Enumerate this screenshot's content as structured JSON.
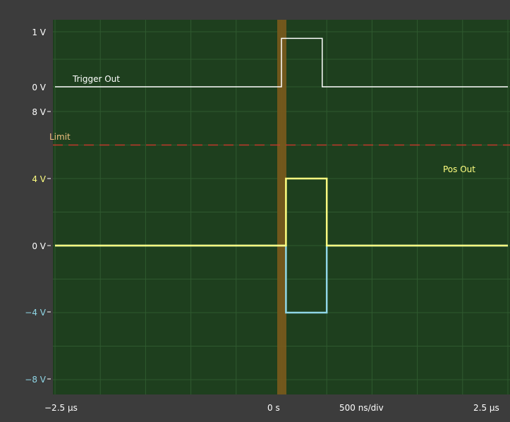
{
  "scope": {
    "colors": {
      "background": "#3c3c3c",
      "plot_bg": "#1e3f1e",
      "grid": "#2f5a2f",
      "trigger_band": "#7a5a1c",
      "trigger_trace": "#ffffff",
      "limit_line": "#c0392b",
      "pos_trace": "#ffff80",
      "neg_trace": "#8fd6e6",
      "axis_text": "#ffffff"
    },
    "trigger_panel": {
      "y_labels": [
        "1 V",
        "0 V"
      ],
      "trace_label": "Trigger Out"
    },
    "main_panel": {
      "y_labels": [
        "8 V",
        "4 V",
        "0 V",
        "−4 V",
        "−8 V"
      ],
      "limit_label": "Limit",
      "trace_label": "Pos Out"
    },
    "x_axis": {
      "labels": [
        "−2.5 µs",
        "0 s",
        "500 ns/div",
        "2.5 µs"
      ]
    }
  },
  "chart_data": [
    {
      "type": "line",
      "series": [
        {
          "name": "Trigger Out",
          "x_us": [
            -2.5,
            0.0,
            0.0,
            0.45,
            0.45,
            2.5
          ],
          "y": [
            0,
            0,
            0.88,
            0.88,
            0,
            0
          ]
        }
      ],
      "ylim": [
        -0.9,
        1.3
      ],
      "xlim_us": [
        -2.5,
        2.5
      ],
      "grid": true
    },
    {
      "type": "line",
      "series": [
        {
          "name": "Pos Out",
          "x_us": [
            -2.5,
            0.05,
            0.05,
            0.5,
            0.5,
            2.5
          ],
          "y": [
            0,
            0,
            4,
            4,
            0,
            0
          ]
        },
        {
          "x_us": [
            -2.5,
            0.05,
            0.05,
            0.5,
            0.5,
            2.5
          ],
          "y": [
            0,
            0,
            -4,
            -4,
            0,
            0
          ]
        }
      ],
      "limit": 6,
      "ylim": [
        -8.3,
        8.3
      ],
      "xlim_us": [
        -2.5,
        2.5
      ],
      "grid": true
    }
  ]
}
